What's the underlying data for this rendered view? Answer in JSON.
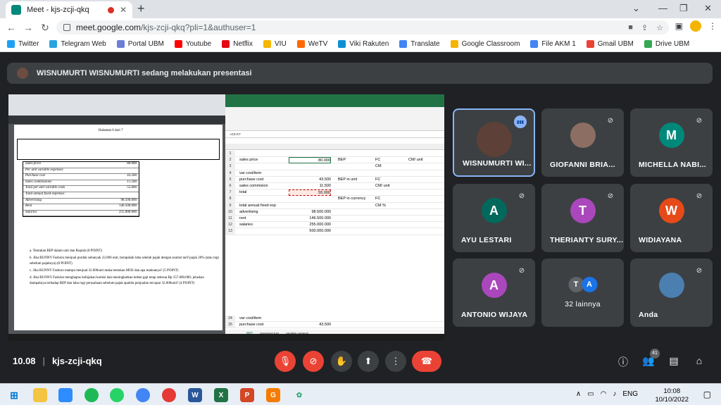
{
  "browser": {
    "tab_title": "Meet - kjs-zcji-qkq",
    "tab_close": "✕",
    "new_tab": "+",
    "url_host": "meet.google.com",
    "url_path": "/kjs-zcji-qkq?pli=1&authuser=1",
    "bookmarks": [
      {
        "label": "Twitter",
        "color": "#1da1f2"
      },
      {
        "label": "Telegram Web",
        "color": "#2aa3e0"
      },
      {
        "label": "Portal UBM",
        "color": "#6b7fd7"
      },
      {
        "label": "Youtube",
        "color": "#ff0000"
      },
      {
        "label": "Netflix",
        "color": "#e50914"
      },
      {
        "label": "VIU",
        "color": "#f5b700"
      },
      {
        "label": "WeTV",
        "color": "#ff6a00"
      },
      {
        "label": "Viki Rakuten",
        "color": "#0e8fd4"
      },
      {
        "label": "Translate",
        "color": "#4285f4"
      },
      {
        "label": "Google Classroom",
        "color": "#f4b400"
      },
      {
        "label": "File AKM 1",
        "color": "#4285f4"
      },
      {
        "label": "Gmail UBM",
        "color": "#ea4335"
      },
      {
        "label": "Drive UBM",
        "color": "#34a853"
      }
    ]
  },
  "presentation": {
    "banner": "WISNUMURTI WISNUMURTI sedang melakukan presentasi"
  },
  "shared_screen": {
    "pdf_header": "Halaman 6 dari 7",
    "pdf_rows": [
      [
        "Sales price",
        "80.000"
      ],
      [
        "Per unit variable expenses:",
        ""
      ],
      [
        "Purchase cost",
        "43.500"
      ],
      [
        "Sales commissions",
        "11.500"
      ],
      [
        "Total per unit variable costs",
        "55.000"
      ],
      [
        "Total annual fixed expenses:",
        ""
      ],
      [
        "Advertising",
        "98.500.000"
      ],
      [
        "Rent",
        "146.500.000"
      ],
      [
        "Salaries",
        "255.000.000"
      ]
    ],
    "pdf_questions": [
      "a. Tentukan BEP dalam unit dan Rupiah (8 POINT)",
      "b. Jika BUNNY Fashion menjual produk sebanyak 22.000 unit, berapakah laba setelah pajak dengan asumsi tarif pajak 20% (atau rugi sebelum pajaknya) (8 POINT)",
      "c. Jika BUNNY Fashion mampu menjual 32.000unit maka tentukan MOS dan apa maknanya? (5 POINT)",
      "d. Jika BUNNY Fashion menghapus kebijakan komisi dan meningkatkan beban gaji tetap sebesar Rp 157.000.000; jelaskan dampaknya terhadap BEP dan laba rugi perusahaan sebelum pajak apabila penjualan tercapai 32.000unit? (4 POINT)"
    ],
    "formula": "=C2-C7",
    "sheet_rows": [
      {
        "n": "1",
        "b": "",
        "c": "",
        "e": "",
        "f": ""
      },
      {
        "n": "2",
        "b": "sales price",
        "c": "80.000",
        "e": "BEP",
        "f": "FC"
      },
      {
        "n": "3",
        "b": "",
        "c": "",
        "e": "",
        "f": "CM"
      },
      {
        "n": "4",
        "b": "var cost/item",
        "c": "",
        "e": "",
        "f": ""
      },
      {
        "n": "5",
        "b": "purchase cost",
        "c": "43.500",
        "e": "BEP in unit",
        "f": "FC"
      },
      {
        "n": "6",
        "b": "sales commision",
        "c": "11.500",
        "e": "",
        "f": "CM/ unit"
      },
      {
        "n": "7",
        "b": "total",
        "c": "55.000",
        "e": "",
        "f": ""
      },
      {
        "n": "8",
        "b": "",
        "c": "",
        "e": "BEP in currency",
        "f": "FC"
      },
      {
        "n": "9",
        "b": "total annual fixed exp",
        "c": "",
        "e": "",
        "f": "CM %"
      },
      {
        "n": "10",
        "b": "advertising",
        "c": "98.500.000",
        "e": "",
        "f": ""
      },
      {
        "n": "11",
        "b": "rent",
        "c": "146.500.000",
        "e": "",
        "f": ""
      },
      {
        "n": "12",
        "b": "salaries",
        "c": "255.000.000",
        "e": "",
        "f": ""
      },
      {
        "n": "13",
        "b": "",
        "c": "500.000.000",
        "e": "",
        "f": ""
      }
    ],
    "sheet_g2": "CM/ unit",
    "sheet_tail": [
      {
        "n": "24",
        "b": "var cost/item",
        "c": ""
      },
      {
        "n": "25",
        "b": "purchase cost",
        "c": "43.500"
      }
    ],
    "sheet_tabs": [
      "BEP",
      "anggaran kas",
      "analisis variansi"
    ]
  },
  "participants": [
    {
      "name": "WISNUMURTI WI...",
      "initial": "",
      "color": "#5d4037",
      "speaking": true
    },
    {
      "name": "GIOFANNI BRIA...",
      "initial": "",
      "color": "#8d6e63",
      "speaking": false
    },
    {
      "name": "MICHELLA NABI...",
      "initial": "M",
      "color": "#00897b",
      "speaking": false
    },
    {
      "name": "AYU LESTARI",
      "initial": "A",
      "color": "#00695c",
      "speaking": false
    },
    {
      "name": "THERIANTY SURY...",
      "initial": "T",
      "color": "#ab47bc",
      "speaking": false
    },
    {
      "name": "WIDIAYANA",
      "initial": "W",
      "color": "#e64a19",
      "speaking": false
    },
    {
      "name": "ANTONIO WIJAYA",
      "initial": "A",
      "color": "#ab47bc",
      "speaking": false
    },
    {
      "name": "32 lainnya",
      "initial": "",
      "color": "#5f6368",
      "speaking": false
    },
    {
      "name": "Anda",
      "initial": "",
      "color": "#4a7fb0",
      "speaking": false
    }
  ],
  "others_avatars": [
    "T",
    "A"
  ],
  "meeting": {
    "time": "10.08",
    "code": "kjs-zcji-qkq",
    "people_count": "41"
  },
  "taskbar": {
    "lang": "ENG",
    "time": "10:08",
    "date": "10/10/2022"
  }
}
